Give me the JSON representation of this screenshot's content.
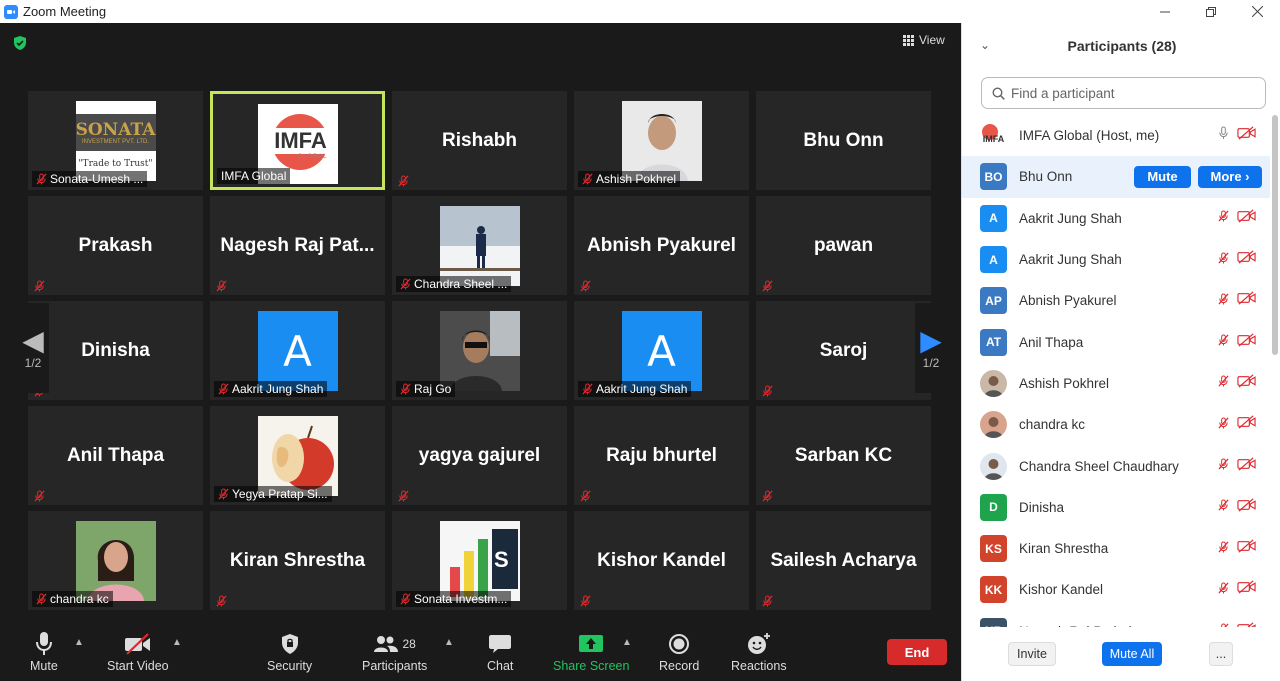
{
  "window": {
    "title": "Zoom Meeting",
    "controls": [
      "minimize",
      "restore",
      "close"
    ]
  },
  "meeting": {
    "view_label": "View",
    "page_indicator_left": "1/2",
    "page_indicator_right": "1/2",
    "tiles": [
      {
        "name": "Sonata-Umesh ...",
        "type": "image",
        "image": "sonata-logo",
        "logo_line1": "SONATA",
        "logo_line2": "INVESTMENT PVT. LTD.",
        "logo_tagline": "\"Trade to Trust\"",
        "muted": true
      },
      {
        "name": "IMFA Global",
        "type": "image",
        "image": "imfa-logo",
        "logo_text": "IMFA",
        "logo_subtext": "GLOBAL",
        "active": true,
        "muted": false
      },
      {
        "name": "Rishabh",
        "type": "text",
        "muted": true
      },
      {
        "name": "Ashish Pokhrel",
        "type": "image",
        "image": "person-photo",
        "muted": true
      },
      {
        "name": "Bhu Onn",
        "type": "text",
        "muted": false
      },
      {
        "name": "Prakash",
        "type": "text",
        "muted": true
      },
      {
        "name": "Nagesh  Raj  Pat...",
        "type": "text",
        "muted": true
      },
      {
        "name": "Chandra Sheel ...",
        "type": "image",
        "image": "snow-photo",
        "muted": true
      },
      {
        "name": "Abnish Pyakurel",
        "type": "text",
        "muted": true
      },
      {
        "name": "pawan",
        "type": "text",
        "muted": true
      },
      {
        "name": "Dinisha",
        "type": "text",
        "muted": true
      },
      {
        "name": "Aakrit Jung Shah",
        "type": "image",
        "image": "avatar-a",
        "letter": "A",
        "muted": true
      },
      {
        "name": "Raj Go",
        "type": "image",
        "image": "car-photo",
        "muted": true
      },
      {
        "name": "Aakrit Jung Shah",
        "type": "image",
        "image": "avatar-a",
        "letter": "A",
        "muted": true
      },
      {
        "name": "Saroj",
        "type": "text",
        "muted": true
      },
      {
        "name": "Anil Thapa",
        "type": "text",
        "muted": true
      },
      {
        "name": "Yegya Pratap Si...",
        "type": "image",
        "image": "apple-photo",
        "muted": true
      },
      {
        "name": "yagya gajurel",
        "type": "text",
        "muted": true
      },
      {
        "name": "Raju bhurtel",
        "type": "text",
        "muted": true
      },
      {
        "name": "Sarban KC",
        "type": "text",
        "muted": true
      },
      {
        "name": "chandra kc",
        "type": "image",
        "image": "woman-photo",
        "muted": true
      },
      {
        "name": "Kiran Shrestha",
        "type": "text",
        "muted": true
      },
      {
        "name": "Sonata Investm...",
        "type": "image",
        "image": "chart-photo",
        "muted": true
      },
      {
        "name": "Kishor Kandel",
        "type": "text",
        "muted": true
      },
      {
        "name": "Sailesh Acharya",
        "type": "text",
        "muted": true
      }
    ]
  },
  "toolbar": {
    "mute": "Mute",
    "start_video": "Start Video",
    "security": "Security",
    "participants": "Participants",
    "participants_count": "28",
    "chat": "Chat",
    "share_screen": "Share Screen",
    "record": "Record",
    "reactions": "Reactions",
    "end": "End"
  },
  "panel": {
    "title": "Participants (28)",
    "search_placeholder": "Find a participant",
    "mute_btn": "Mute",
    "more_btn": "More",
    "participants": [
      {
        "name": "IMFA Global (Host, me)",
        "avatar": "logo",
        "avatar_text": "IMFA",
        "color": "#ffffff",
        "mic": "on"
      },
      {
        "name": "Bhu Onn",
        "avatar": "initials",
        "initials": "BO",
        "color": "#3b79c2",
        "highlight": true
      },
      {
        "name": "Aakrit Jung Shah",
        "avatar": "initials",
        "initials": "A",
        "color": "#1a8df2"
      },
      {
        "name": "Aakrit Jung Shah",
        "avatar": "initials",
        "initials": "A",
        "color": "#1a8df2"
      },
      {
        "name": "Abnish Pyakurel",
        "avatar": "initials",
        "initials": "AP",
        "color": "#3b79c2"
      },
      {
        "name": "Anil Thapa",
        "avatar": "initials",
        "initials": "AT",
        "color": "#3b79c2"
      },
      {
        "name": "Ashish Pokhrel",
        "avatar": "photo",
        "color": "#c9b8a8"
      },
      {
        "name": "chandra kc",
        "avatar": "photo",
        "color": "#d9a48c"
      },
      {
        "name": "Chandra Sheel Chaudhary",
        "avatar": "photo",
        "color": "#dfe6ee"
      },
      {
        "name": "Dinisha",
        "avatar": "initials",
        "initials": "D",
        "color": "#1ea44c"
      },
      {
        "name": "Kiran Shrestha",
        "avatar": "initials",
        "initials": "KS",
        "color": "#d2432c"
      },
      {
        "name": "Kishor Kandel",
        "avatar": "initials",
        "initials": "KK",
        "color": "#d2432c"
      },
      {
        "name": "Nagesh Raj Pathak",
        "avatar": "initials",
        "initials": "NR",
        "color": "#3b5266"
      }
    ],
    "footer": {
      "invite": "Invite",
      "mute_all": "Mute All",
      "more": "..."
    }
  },
  "colors": {
    "accent": "#0e72ed",
    "end": "#d72a2a",
    "share_green": "#21c45e",
    "muted_red": "#e0282e",
    "active_border": "#c6e55a"
  }
}
